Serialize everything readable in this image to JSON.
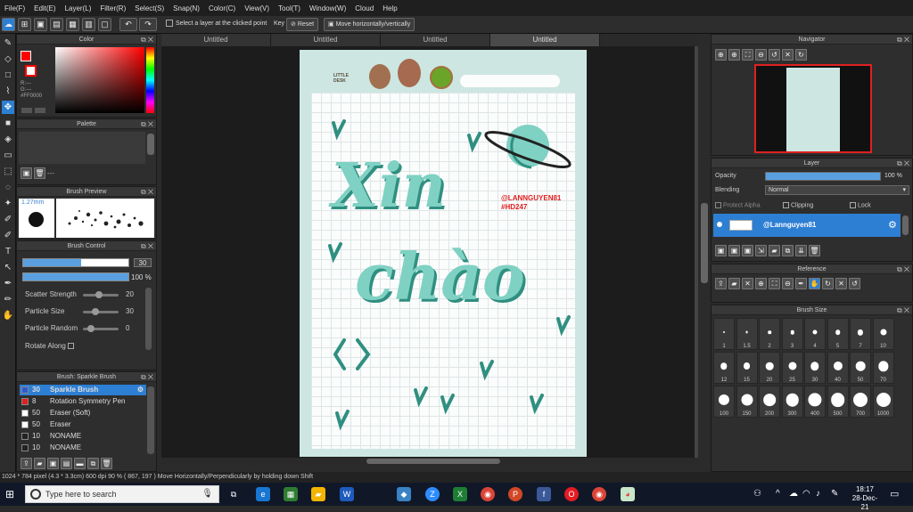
{
  "menu": [
    "File(F)",
    "Edit(E)",
    "Layer(L)",
    "Filter(R)",
    "Select(S)",
    "Snap(N)",
    "Color(C)",
    "View(V)",
    "Tool(T)",
    "Window(W)",
    "Cloud",
    "Help"
  ],
  "toolbar": {
    "select_layer_label": "Select a layer at the clicked point",
    "key_label": "Key",
    "reset_label": "Reset",
    "move_label": "Move horizontally/vertically"
  },
  "color_panel": {
    "title": "Color",
    "r": "R:---",
    "g": "G:---",
    "hex": "#FF0000",
    "accent": "#ff0000"
  },
  "palette_panel": {
    "title": "Palette",
    "dash": "---"
  },
  "brush_preview": {
    "title": "Brush Preview",
    "size": "1.27mm"
  },
  "brush_control": {
    "title": "Brush Control",
    "size_value": "30",
    "opacity_value": "100 %",
    "params": [
      {
        "label": "Scatter Strength",
        "value": "20",
        "level": 0.35
      },
      {
        "label": "Particle Size",
        "value": "30",
        "level": 0.25
      },
      {
        "label": "Particle Random",
        "value": "0",
        "level": 0.12
      }
    ],
    "rotate_label": "Rotate Along"
  },
  "brush_list": {
    "title": "Brush: Sparkle Brush",
    "items": [
      {
        "size": "30",
        "name": "Sparkle Brush",
        "color": "#2d5bd3",
        "selected": true
      },
      {
        "size": "8",
        "name": "Rotation Symmetry Pen",
        "color": "#e02020"
      },
      {
        "size": "50",
        "name": "Eraser (Soft)",
        "color": "#ffffff"
      },
      {
        "size": "50",
        "name": "Eraser",
        "color": "#ffffff"
      },
      {
        "size": "10",
        "name": "NONAME",
        "color": "#222222"
      },
      {
        "size": "10",
        "name": "NONAME",
        "color": "#222222"
      }
    ]
  },
  "tabs": [
    "Untitled",
    "Untitled",
    "Untitled",
    "Untitled"
  ],
  "artwork": {
    "brand": "LITTLE DESK",
    "line1": "Xin",
    "line2": "chào",
    "handle": "@LANNGUYEN81",
    "tag": "#HD247",
    "accent": "#7fd1c3",
    "shadow": "#2f8f80"
  },
  "navigator": {
    "title": "Navigator"
  },
  "layer_panel": {
    "title": "Layer",
    "opacity_label": "Opacity",
    "opacity_value": "100 %",
    "opacity_level": 1.0,
    "blending_label": "Blending",
    "blending_value": "Normal",
    "protect_alpha": "Protect Alpha",
    "clipping": "Clipping",
    "lock": "Lock",
    "layer_name": "@Lannguyen81"
  },
  "reference_panel": {
    "title": "Reference"
  },
  "brush_size_panel": {
    "title": "Brush Size",
    "sizes": [
      "1",
      "1.5",
      "2",
      "3",
      "4",
      "5",
      "7",
      "10",
      "12",
      "15",
      "20",
      "25",
      "30",
      "40",
      "50",
      "70",
      "100",
      "150",
      "200",
      "300",
      "400",
      "500",
      "700",
      "1000"
    ]
  },
  "status": {
    "text": "1024 * 784 pixel  (4.3 * 3.3cm)  600 dpi  90 %  ( 867, 197 )  Move Horizontally/Perpendicularly by holding down Shift"
  },
  "taskbar": {
    "search_placeholder": "Type here to search",
    "time": "18:17",
    "date": "28-Dec-21"
  }
}
